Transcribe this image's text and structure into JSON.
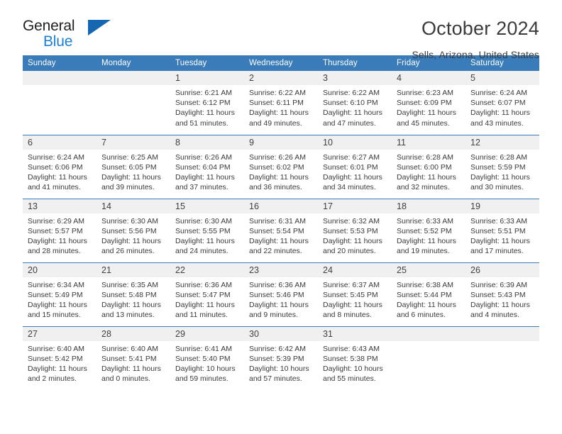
{
  "brand": {
    "name_part1": "General",
    "name_part2": "Blue",
    "triangle_color": "#1667b2",
    "blue_color": "#1b7fd4"
  },
  "header": {
    "month_title": "October 2024",
    "location": "Sells, Arizona, United States",
    "header_bg": "#3a7cba"
  },
  "weekdays": [
    "Sunday",
    "Monday",
    "Tuesday",
    "Wednesday",
    "Thursday",
    "Friday",
    "Saturday"
  ],
  "weeks": [
    [
      {
        "day": "",
        "sunrise": "",
        "sunset": "",
        "daylight": ""
      },
      {
        "day": "",
        "sunrise": "",
        "sunset": "",
        "daylight": ""
      },
      {
        "day": "1",
        "sunrise": "Sunrise: 6:21 AM",
        "sunset": "Sunset: 6:12 PM",
        "daylight": "Daylight: 11 hours and 51 minutes."
      },
      {
        "day": "2",
        "sunrise": "Sunrise: 6:22 AM",
        "sunset": "Sunset: 6:11 PM",
        "daylight": "Daylight: 11 hours and 49 minutes."
      },
      {
        "day": "3",
        "sunrise": "Sunrise: 6:22 AM",
        "sunset": "Sunset: 6:10 PM",
        "daylight": "Daylight: 11 hours and 47 minutes."
      },
      {
        "day": "4",
        "sunrise": "Sunrise: 6:23 AM",
        "sunset": "Sunset: 6:09 PM",
        "daylight": "Daylight: 11 hours and 45 minutes."
      },
      {
        "day": "5",
        "sunrise": "Sunrise: 6:24 AM",
        "sunset": "Sunset: 6:07 PM",
        "daylight": "Daylight: 11 hours and 43 minutes."
      }
    ],
    [
      {
        "day": "6",
        "sunrise": "Sunrise: 6:24 AM",
        "sunset": "Sunset: 6:06 PM",
        "daylight": "Daylight: 11 hours and 41 minutes."
      },
      {
        "day": "7",
        "sunrise": "Sunrise: 6:25 AM",
        "sunset": "Sunset: 6:05 PM",
        "daylight": "Daylight: 11 hours and 39 minutes."
      },
      {
        "day": "8",
        "sunrise": "Sunrise: 6:26 AM",
        "sunset": "Sunset: 6:04 PM",
        "daylight": "Daylight: 11 hours and 37 minutes."
      },
      {
        "day": "9",
        "sunrise": "Sunrise: 6:26 AM",
        "sunset": "Sunset: 6:02 PM",
        "daylight": "Daylight: 11 hours and 36 minutes."
      },
      {
        "day": "10",
        "sunrise": "Sunrise: 6:27 AM",
        "sunset": "Sunset: 6:01 PM",
        "daylight": "Daylight: 11 hours and 34 minutes."
      },
      {
        "day": "11",
        "sunrise": "Sunrise: 6:28 AM",
        "sunset": "Sunset: 6:00 PM",
        "daylight": "Daylight: 11 hours and 32 minutes."
      },
      {
        "day": "12",
        "sunrise": "Sunrise: 6:28 AM",
        "sunset": "Sunset: 5:59 PM",
        "daylight": "Daylight: 11 hours and 30 minutes."
      }
    ],
    [
      {
        "day": "13",
        "sunrise": "Sunrise: 6:29 AM",
        "sunset": "Sunset: 5:57 PM",
        "daylight": "Daylight: 11 hours and 28 minutes."
      },
      {
        "day": "14",
        "sunrise": "Sunrise: 6:30 AM",
        "sunset": "Sunset: 5:56 PM",
        "daylight": "Daylight: 11 hours and 26 minutes."
      },
      {
        "day": "15",
        "sunrise": "Sunrise: 6:30 AM",
        "sunset": "Sunset: 5:55 PM",
        "daylight": "Daylight: 11 hours and 24 minutes."
      },
      {
        "day": "16",
        "sunrise": "Sunrise: 6:31 AM",
        "sunset": "Sunset: 5:54 PM",
        "daylight": "Daylight: 11 hours and 22 minutes."
      },
      {
        "day": "17",
        "sunrise": "Sunrise: 6:32 AM",
        "sunset": "Sunset: 5:53 PM",
        "daylight": "Daylight: 11 hours and 20 minutes."
      },
      {
        "day": "18",
        "sunrise": "Sunrise: 6:33 AM",
        "sunset": "Sunset: 5:52 PM",
        "daylight": "Daylight: 11 hours and 19 minutes."
      },
      {
        "day": "19",
        "sunrise": "Sunrise: 6:33 AM",
        "sunset": "Sunset: 5:51 PM",
        "daylight": "Daylight: 11 hours and 17 minutes."
      }
    ],
    [
      {
        "day": "20",
        "sunrise": "Sunrise: 6:34 AM",
        "sunset": "Sunset: 5:49 PM",
        "daylight": "Daylight: 11 hours and 15 minutes."
      },
      {
        "day": "21",
        "sunrise": "Sunrise: 6:35 AM",
        "sunset": "Sunset: 5:48 PM",
        "daylight": "Daylight: 11 hours and 13 minutes."
      },
      {
        "day": "22",
        "sunrise": "Sunrise: 6:36 AM",
        "sunset": "Sunset: 5:47 PM",
        "daylight": "Daylight: 11 hours and 11 minutes."
      },
      {
        "day": "23",
        "sunrise": "Sunrise: 6:36 AM",
        "sunset": "Sunset: 5:46 PM",
        "daylight": "Daylight: 11 hours and 9 minutes."
      },
      {
        "day": "24",
        "sunrise": "Sunrise: 6:37 AM",
        "sunset": "Sunset: 5:45 PM",
        "daylight": "Daylight: 11 hours and 8 minutes."
      },
      {
        "day": "25",
        "sunrise": "Sunrise: 6:38 AM",
        "sunset": "Sunset: 5:44 PM",
        "daylight": "Daylight: 11 hours and 6 minutes."
      },
      {
        "day": "26",
        "sunrise": "Sunrise: 6:39 AM",
        "sunset": "Sunset: 5:43 PM",
        "daylight": "Daylight: 11 hours and 4 minutes."
      }
    ],
    [
      {
        "day": "27",
        "sunrise": "Sunrise: 6:40 AM",
        "sunset": "Sunset: 5:42 PM",
        "daylight": "Daylight: 11 hours and 2 minutes."
      },
      {
        "day": "28",
        "sunrise": "Sunrise: 6:40 AM",
        "sunset": "Sunset: 5:41 PM",
        "daylight": "Daylight: 11 hours and 0 minutes."
      },
      {
        "day": "29",
        "sunrise": "Sunrise: 6:41 AM",
        "sunset": "Sunset: 5:40 PM",
        "daylight": "Daylight: 10 hours and 59 minutes."
      },
      {
        "day": "30",
        "sunrise": "Sunrise: 6:42 AM",
        "sunset": "Sunset: 5:39 PM",
        "daylight": "Daylight: 10 hours and 57 minutes."
      },
      {
        "day": "31",
        "sunrise": "Sunrise: 6:43 AM",
        "sunset": "Sunset: 5:38 PM",
        "daylight": "Daylight: 10 hours and 55 minutes."
      },
      {
        "day": "",
        "sunrise": "",
        "sunset": "",
        "daylight": ""
      },
      {
        "day": "",
        "sunrise": "",
        "sunset": "",
        "daylight": ""
      }
    ]
  ]
}
